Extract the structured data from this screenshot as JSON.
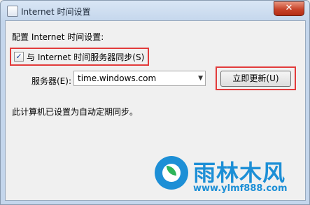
{
  "window": {
    "title": "Internet 时间设置",
    "close_label": "✕"
  },
  "main": {
    "section_label": "配置 Internet 时间设置:",
    "sync_checkbox": {
      "label": "与 Internet 时间服务器同步(S)",
      "checked": true,
      "check_glyph": "✓"
    },
    "server": {
      "label": "服务器(E):",
      "value": "time.windows.com",
      "arrow": "▼"
    },
    "update_button": "立即更新(U)",
    "status": "此计算机已设置为自动定期同步。"
  },
  "watermark": {
    "name": "雨林木风",
    "url": "www.ylmf888.com"
  },
  "colors": {
    "highlight_border": "#e23b3b",
    "watermark_blue": "#1d8fd6"
  }
}
